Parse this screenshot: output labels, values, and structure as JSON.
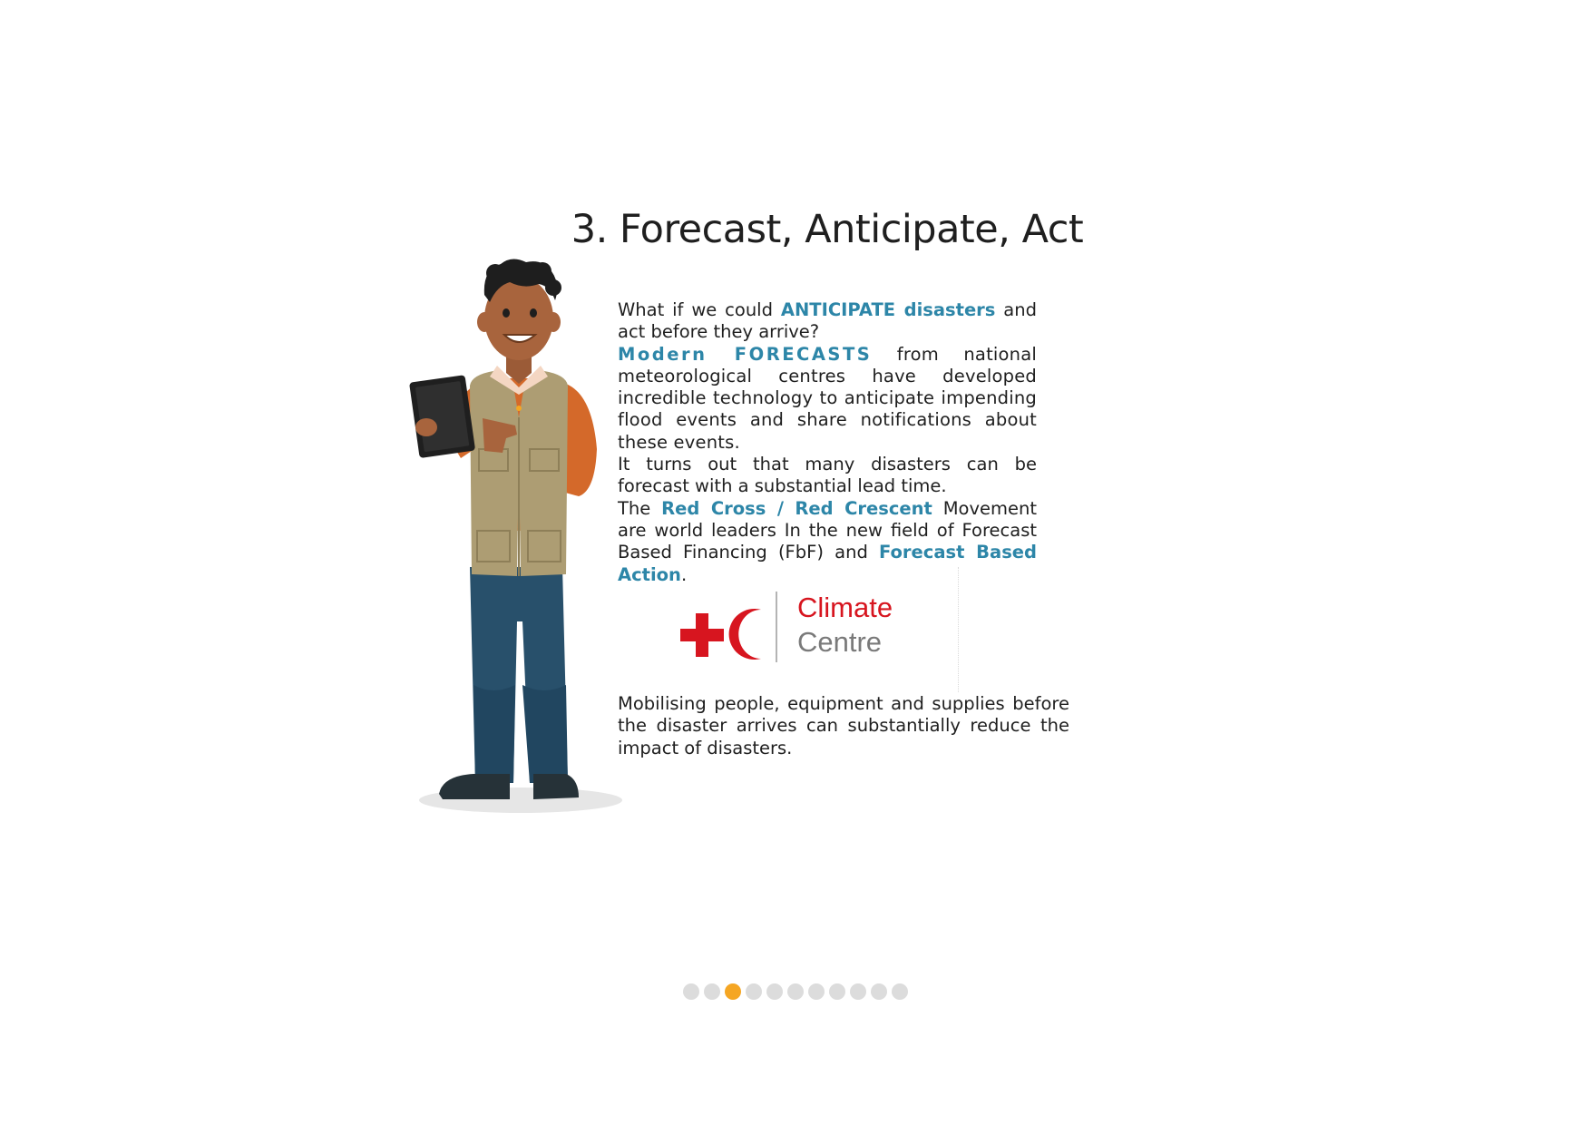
{
  "slide": {
    "title": "3. Forecast, Anticipate, Act"
  },
  "paragraphs": {
    "p1_pre": "What if we could ",
    "p1_hl": "ANTICIPATE disasters",
    "p1_post": " and act before they arrive?",
    "p2_hl": "Modern FORECASTS",
    "p2_post": " from national meteorological centres have developed incredible technology to anticipate impending flood events and share notifications about these events.",
    "p3": "It turns out that many disasters can be forecast with a substantial lead time.",
    "p4_pre": "The ",
    "p4_hl1": "Red Cross / Red Crescent",
    "p4_mid": " Movement are world leaders In the new field of Forecast Based Financing (FbF) and ",
    "p4_hl2": "Forecast Based Action",
    "p4_post": "."
  },
  "logo": {
    "line1": "Climate",
    "line2": "Centre",
    "red": "#d7151f",
    "grey": "#7a7a7a"
  },
  "bottom": {
    "text": "Mobilising people, equipment and supplies before the disaster arrives can substantially reduce the impact of disasters."
  },
  "pagination": {
    "total": 11,
    "active": 3,
    "active_color": "#f5a623",
    "inactive_color": "#dcdcdc"
  },
  "colors": {
    "highlight": "#2d86a8"
  }
}
